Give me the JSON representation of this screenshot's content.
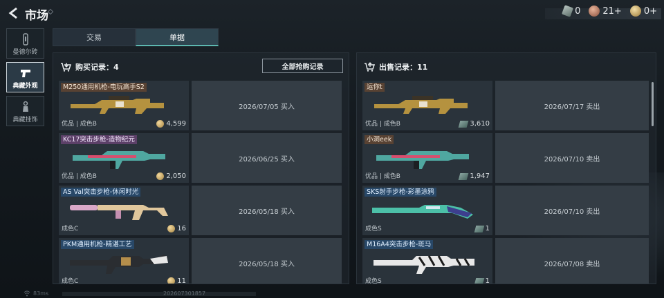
{
  "header": {
    "title": "市场",
    "currencies": [
      {
        "icon": "ticket-icon",
        "value": "0"
      },
      {
        "icon": "bronze-coin-icon",
        "value": "21+"
      },
      {
        "icon": "gold-coin-icon",
        "value": "0+"
      }
    ]
  },
  "sidebar": {
    "items": [
      {
        "label": "曼德尔砖",
        "icon": "brick-icon"
      },
      {
        "label": "典藏外观",
        "icon": "pistol-icon"
      },
      {
        "label": "典藏挂饰",
        "icon": "charm-icon"
      }
    ]
  },
  "tabs": [
    {
      "label": "交易"
    },
    {
      "label": "单据"
    }
  ],
  "buy": {
    "title": "购买记录：4",
    "all_button": "全部抢购记录",
    "rows": [
      {
        "name": "M250通用机枪-电玩高手S2",
        "quality": "优品 | 成色B",
        "price": "4,599",
        "price_icon": "coin",
        "info": "2026/07/05 买入"
      },
      {
        "name": "KC17突击步枪-造物纪元",
        "quality": "优品 | 成色B",
        "price": "2,050",
        "price_icon": "coin",
        "info": "2026/06/25 买入"
      },
      {
        "name": "AS Val突击步枪-休闲时光",
        "quality": "成色C",
        "price": "16",
        "price_icon": "coin",
        "info": "2026/05/18 买入"
      },
      {
        "name": "PKM通用机枪-精湛工艺",
        "quality": "成色C",
        "price": "11",
        "price_icon": "coin",
        "info": "2026/05/18 买入"
      }
    ]
  },
  "sell": {
    "title": "出售记录：11",
    "rows": [
      {
        "name": "运你t",
        "quality": "优品 | 成色B",
        "price": "3,610",
        "price_icon": "note",
        "info": "2026/07/17 卖出"
      },
      {
        "name": "小洞eek",
        "quality": "优品 | 成色B",
        "price": "1,947",
        "price_icon": "note",
        "info": "2026/07/10 卖出"
      },
      {
        "name": "SKS射手步枪-彩墨涂鸦",
        "quality": "成色S",
        "price": "1",
        "price_icon": "note",
        "info": "2026/07/10 卖出"
      },
      {
        "name": "M16A4突击步枪-斑马",
        "quality": "成色S",
        "price": "1",
        "price_icon": "note",
        "info": "2026/07/08 卖出"
      }
    ]
  },
  "footer": {
    "ping": "83ms",
    "uid": "202607301857"
  }
}
